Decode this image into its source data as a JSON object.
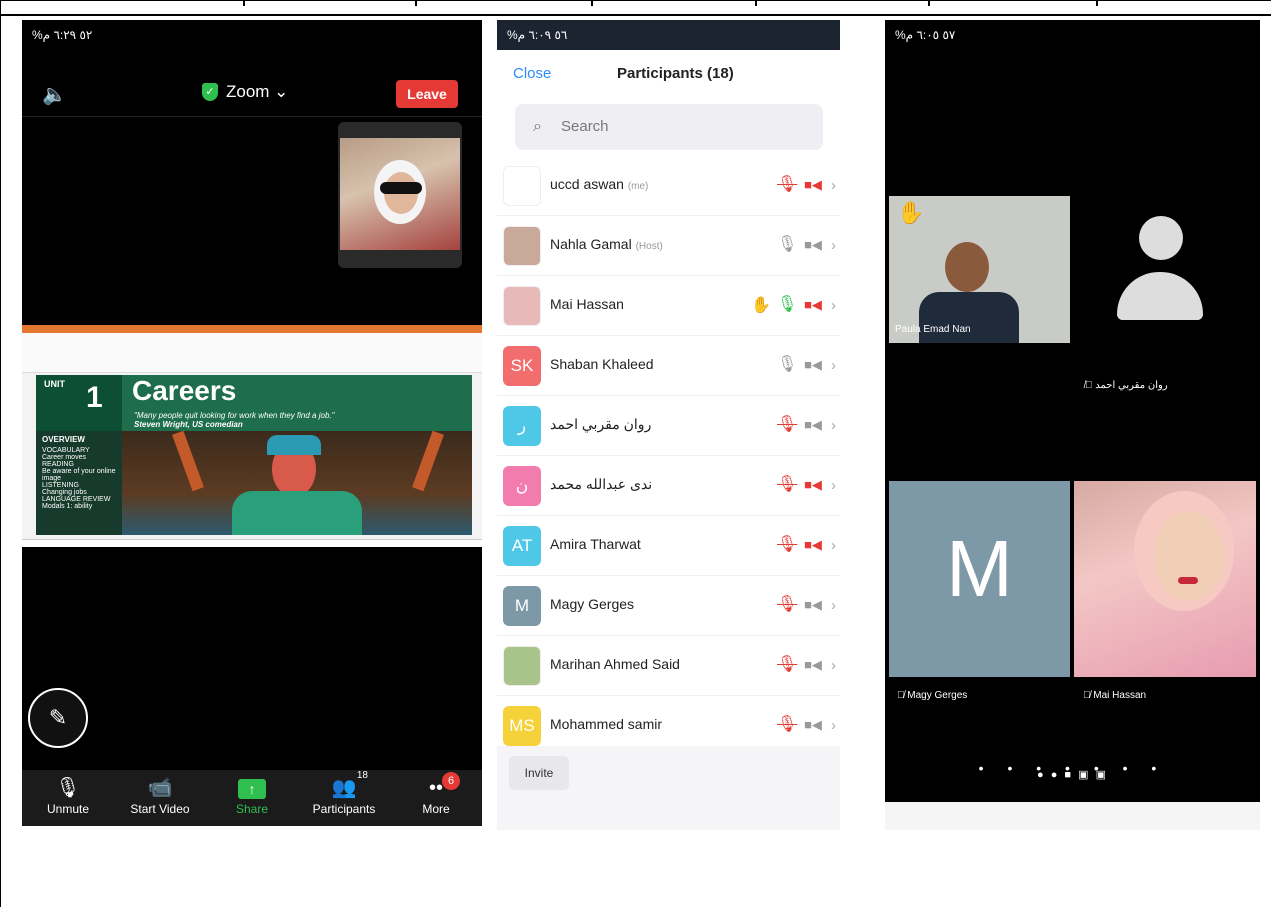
{
  "phone1": {
    "status": {
      "time": "٦:٢٩ م",
      "battery": "%٥٢"
    },
    "zoom_label": "Zoom ⌄",
    "leave_label": "Leave",
    "slide": {
      "unit_label": "UNIT",
      "unit_number": "1",
      "title": "Careers",
      "quote": "\"Many people quit looking for work when they find a job.\"",
      "quote_author": "Steven Wright, US comedian",
      "overview_heading": "OVERVIEW",
      "overview_items": [
        "VOCABULARY",
        "Career moves",
        "READING",
        "Be aware of your online image",
        "LISTENING",
        "Changing jobs",
        "LANGUAGE REVIEW",
        "Modals 1: ability"
      ]
    },
    "toolbar": {
      "unmute": "Unmute",
      "start_video": "Start Video",
      "share": "Share",
      "participants": "Participants",
      "participants_count": "18",
      "more": "More",
      "more_badge": "6"
    }
  },
  "phone2": {
    "status": {
      "time": "٦:٠٩ م",
      "battery": "%٥٦"
    },
    "close_label": "Close",
    "title": "Participants (18)",
    "search_placeholder": "Search",
    "participants": [
      {
        "name": "uccd aswan",
        "tag": "(me)",
        "initials": "",
        "avatar_color": "#ffffff",
        "mic": "muted",
        "cam": "off",
        "hand": false
      },
      {
        "name": "Nahla Gamal",
        "tag": "(Host)",
        "initials": "",
        "avatar_color": "#c9a99a",
        "mic": "on",
        "cam": "on",
        "hand": false
      },
      {
        "name": "Mai Hassan",
        "tag": "",
        "initials": "",
        "avatar_color": "#e8b9b9",
        "mic": "active",
        "cam": "off",
        "hand": true
      },
      {
        "name": "Shaban Khaleed",
        "tag": "",
        "initials": "SK",
        "avatar_color": "#f26d6d",
        "mic": "on",
        "cam": "on",
        "hand": false
      },
      {
        "name": "روان مقربي احمد",
        "tag": "",
        "initials": "ر",
        "avatar_color": "#4fc7e6",
        "mic": "muted",
        "cam": "on",
        "hand": false
      },
      {
        "name": "ندى عبدالله محمد",
        "tag": "",
        "initials": "ن",
        "avatar_color": "#f27cae",
        "mic": "muted",
        "cam": "off",
        "hand": false
      },
      {
        "name": "Amira Tharwat",
        "tag": "",
        "initials": "AT",
        "avatar_color": "#4fc7e6",
        "mic": "muted",
        "cam": "off",
        "hand": false
      },
      {
        "name": "Magy Gerges",
        "tag": "",
        "initials": "M",
        "avatar_color": "#7d98a6",
        "mic": "muted",
        "cam": "on",
        "hand": false
      },
      {
        "name": "Marihan Ahmed Said",
        "tag": "",
        "initials": "",
        "avatar_color": "#a8c48a",
        "mic": "muted",
        "cam": "on",
        "hand": false
      },
      {
        "name": "Mohammed samir",
        "tag": "",
        "initials": "MS",
        "avatar_color": "#f5d23a",
        "mic": "muted",
        "cam": "on",
        "hand": false
      }
    ],
    "invite_label": "Invite"
  },
  "phone3": {
    "status": {
      "time": "٦:٠٥ م",
      "battery": "%٥٧"
    },
    "tiles": {
      "paula": "Paula Emad Nan",
      "rawan": "روان مقربي احمد",
      "magy_initial": "M",
      "magy": "Magy Gerges",
      "mai": "Mai Hassan"
    },
    "page_dots": "• • • • • • •"
  },
  "colors": {
    "zoom_blue": "#2d8cff",
    "leave_red": "#e53935",
    "share_green": "#2fbf4f",
    "muted_red": "#e53935"
  }
}
